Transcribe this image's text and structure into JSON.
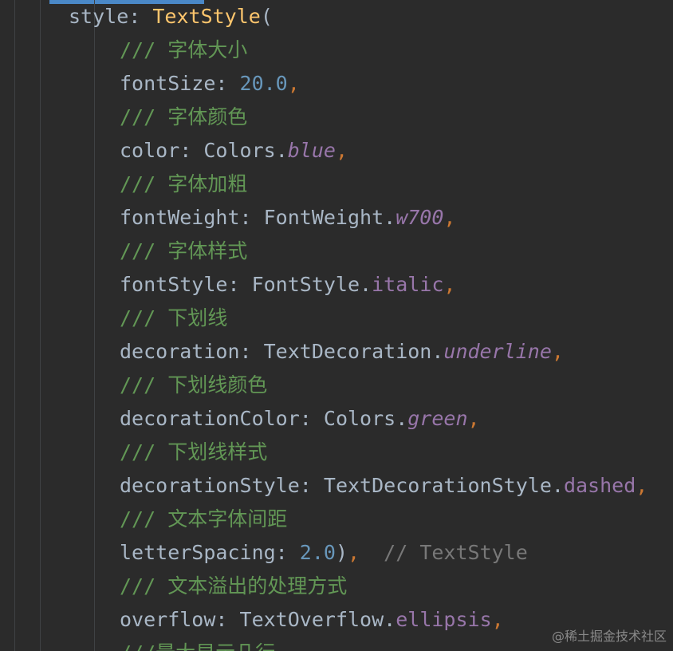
{
  "lines": [
    {
      "parts": [
        "style",
        ": ",
        "TextStyle",
        "("
      ]
    },
    {
      "parts": [
        "/// 字体大小"
      ]
    },
    {
      "parts": [
        "fontSize",
        ": ",
        "20.0",
        ","
      ]
    },
    {
      "parts": [
        "/// 字体颜色"
      ]
    },
    {
      "parts": [
        "color",
        ": ",
        "Colors",
        ".",
        "blue",
        ","
      ]
    },
    {
      "parts": [
        "/// 字体加粗"
      ]
    },
    {
      "parts": [
        "fontWeight",
        ": ",
        "FontWeight",
        ".",
        "w700",
        ","
      ]
    },
    {
      "parts": [
        "/// 字体样式"
      ]
    },
    {
      "parts": [
        "fontStyle",
        ": ",
        "FontStyle",
        ".",
        "italic",
        ","
      ]
    },
    {
      "parts": [
        "/// 下划线"
      ]
    },
    {
      "parts": [
        "decoration",
        ": ",
        "TextDecoration",
        ".",
        "underline",
        ","
      ]
    },
    {
      "parts": [
        "/// 下划线颜色"
      ]
    },
    {
      "parts": [
        "decorationColor",
        ": ",
        "Colors",
        ".",
        "green",
        ","
      ]
    },
    {
      "parts": [
        "/// 下划线样式"
      ]
    },
    {
      "parts": [
        "decorationStyle",
        ": ",
        "TextDecorationStyle",
        ".",
        "dashed",
        ","
      ]
    },
    {
      "parts": [
        "/// 文本字体间距"
      ]
    },
    {
      "parts": [
        "letterSpacing",
        ": ",
        "2.0",
        ")",
        ",",
        "// TextStyle"
      ]
    },
    {
      "parts": [
        "/// 文本溢出的处理方式"
      ]
    },
    {
      "parts": [
        "overflow",
        ": ",
        "TextOverflow",
        ".",
        "ellipsis",
        ","
      ]
    },
    {
      "parts": [
        "///最大显示几行"
      ]
    }
  ],
  "watermark": "@稀土掘金技术社区",
  "colors": {
    "background": "#2b2b2b",
    "identifier": "#a9b7c6",
    "class_name": "#ffc66d",
    "number": "#6897bb",
    "punctuation": "#cc7832",
    "constant": "#9876aa",
    "doc_comment": "#629755",
    "inlay_hint": "#787878",
    "tab_indicator": "#4a88c7"
  }
}
